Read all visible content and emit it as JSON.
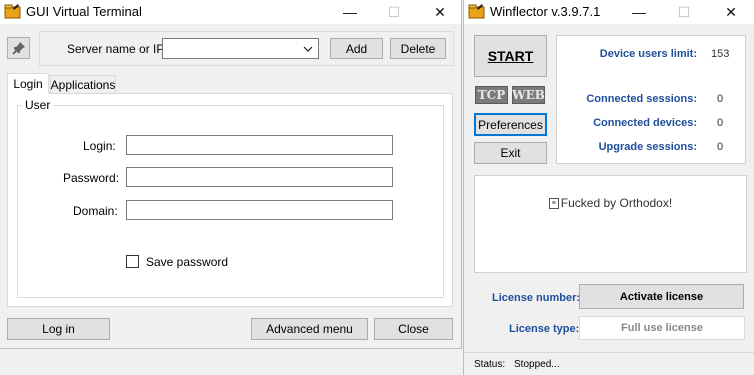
{
  "gui_terminal": {
    "title": "GUI Virtual Terminal",
    "server_label": "Server name or IP:",
    "server_value": "",
    "add_label": "Add",
    "delete_label": "Delete",
    "tabs": [
      {
        "label": "Login",
        "active": true
      },
      {
        "label": "Applications",
        "active": false
      }
    ],
    "group_label": "User",
    "login_label": "Login:",
    "password_label": "Password:",
    "domain_label": "Domain:",
    "save_password_label": "Save password",
    "save_password_checked": false,
    "log_in_label": "Log in",
    "advanced_menu_label": "Advanced menu",
    "close_label": "Close"
  },
  "winflector": {
    "title": "Winflector v.3.9.7.1",
    "start_label": "START",
    "tcp_label": "TCP",
    "web_label": "WEB",
    "preferences_label": "Preferences",
    "exit_label": "Exit",
    "stats": [
      {
        "label": "Device users limit:",
        "value": "153"
      },
      {
        "label": "Connected sessions:",
        "value": "0"
      },
      {
        "label": "Connected devices:",
        "value": "0"
      },
      {
        "label": "Upgrade sessions:",
        "value": "0"
      }
    ],
    "message": "Fucked by Orthodox!",
    "license_number_label": "License number:",
    "activate_license_label": "Activate license",
    "license_type_label": "License type:",
    "license_type_value": "Full use license",
    "status_label": "Status:",
    "status_value": "Stopped..."
  },
  "icons": [
    "app-folder-icon",
    "minimize-icon",
    "maximize-icon",
    "close-icon",
    "pin-icon",
    "dropdown-arrow-icon",
    "checkbox-icon",
    "message-icon"
  ]
}
